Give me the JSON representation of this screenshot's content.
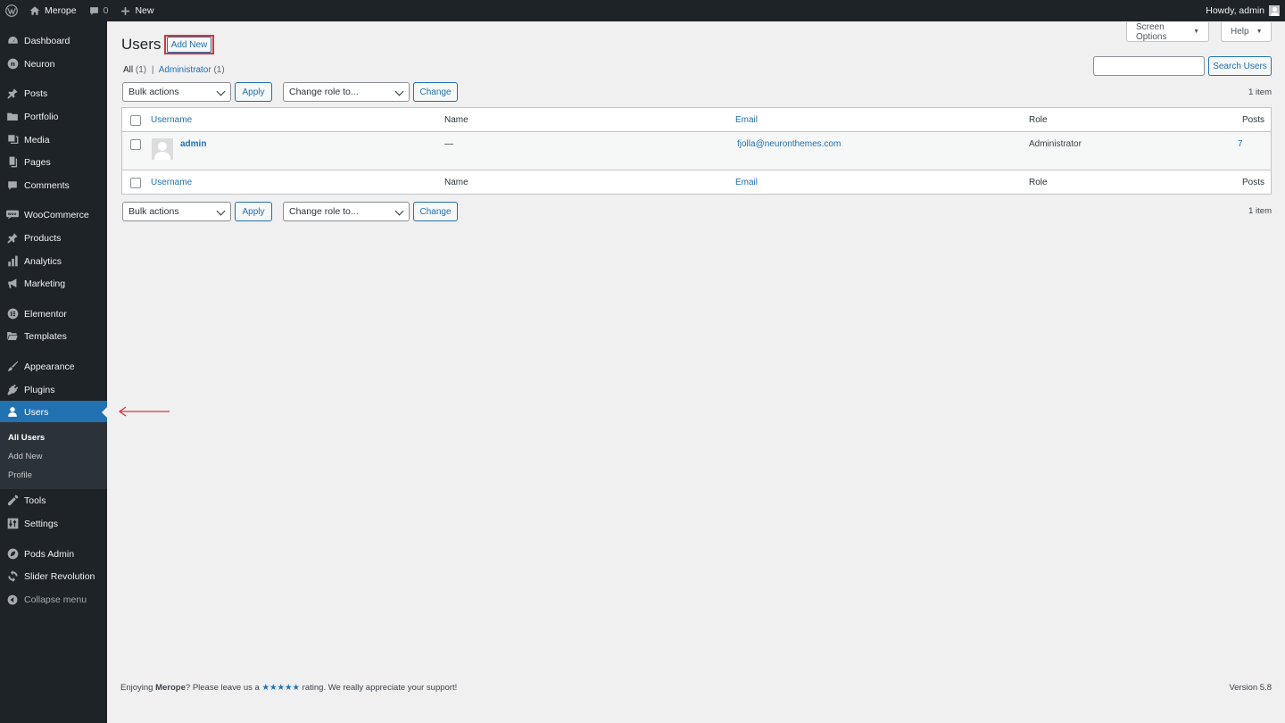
{
  "adminbar": {
    "site_name": "Merope",
    "comments_count": "0",
    "new_label": "New",
    "howdy": "Howdy, admin"
  },
  "sidebar": {
    "items": [
      {
        "label": "Dashboard",
        "icon": "dashboard-icon"
      },
      {
        "label": "Neuron",
        "icon": "neuron-icon"
      },
      {
        "label": "Posts",
        "icon": "pin-icon"
      },
      {
        "label": "Portfolio",
        "icon": "folder-icon"
      },
      {
        "label": "Media",
        "icon": "media-icon"
      },
      {
        "label": "Pages",
        "icon": "pages-icon"
      },
      {
        "label": "Comments",
        "icon": "comment-icon"
      },
      {
        "label": "WooCommerce",
        "icon": "woo-icon"
      },
      {
        "label": "Products",
        "icon": "pin-icon"
      },
      {
        "label": "Analytics",
        "icon": "bar-chart-icon"
      },
      {
        "label": "Marketing",
        "icon": "megaphone-icon"
      },
      {
        "label": "Elementor",
        "icon": "elementor-icon"
      },
      {
        "label": "Templates",
        "icon": "folder-open-icon"
      },
      {
        "label": "Appearance",
        "icon": "brush-icon"
      },
      {
        "label": "Plugins",
        "icon": "plug-icon"
      },
      {
        "label": "Users",
        "icon": "user-icon"
      },
      {
        "label": "Tools",
        "icon": "wrench-icon"
      },
      {
        "label": "Settings",
        "icon": "sliders-icon"
      },
      {
        "label": "Pods Admin",
        "icon": "pods-icon"
      },
      {
        "label": "Slider Revolution",
        "icon": "refresh-icon"
      },
      {
        "label": "Collapse menu",
        "icon": "collapse-icon"
      }
    ],
    "submenu": [
      "All Users",
      "Add New",
      "Profile"
    ]
  },
  "header": {
    "screen_options": "Screen Options",
    "help": "Help",
    "title": "Users",
    "add_new": "Add New"
  },
  "views": {
    "all": "All",
    "all_count": "(1)",
    "separator": "|",
    "admin": "Administrator",
    "admin_count": "(1)"
  },
  "search": {
    "button": "Search Users",
    "value": ""
  },
  "tablenav": {
    "bulk_actions": "Bulk actions",
    "apply": "Apply",
    "change_role": "Change role to...",
    "change": "Change",
    "count": "1 item"
  },
  "table": {
    "columns": [
      "Username",
      "Name",
      "Email",
      "Role",
      "Posts"
    ],
    "rows": [
      {
        "username": "admin",
        "name": "—",
        "email": "fjolla@neuronthemes.com",
        "role": "Administrator",
        "posts": "7"
      }
    ]
  },
  "footer": {
    "text_before": "Enjoying ",
    "brand": "Merope",
    "text_mid": "? Please leave us a ",
    "stars": "★★★★★",
    "text_after": " rating. We really appreciate your support!",
    "version": "Version 5.8"
  },
  "colors": {
    "accent": "#2271b1",
    "sidebar_bg": "#1d2327",
    "highlight": "#d63638"
  }
}
